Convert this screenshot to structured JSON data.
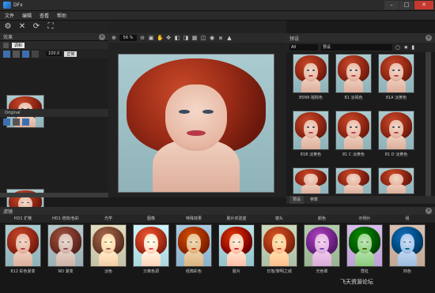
{
  "window": {
    "title": "DFx"
  },
  "menu": [
    "文件",
    "编辑",
    "查看",
    "帮助"
  ],
  "left_panel": {
    "title": "效果",
    "layer_name": "调和",
    "opacity_value": "100.0",
    "blend_mode": "正常",
    "original_label": "Original"
  },
  "zoom": {
    "value": "56 %"
  },
  "right_panel": {
    "title": "预设",
    "category_select": "All",
    "filter_label": "预设",
    "presets": [
      [
        "85N9 褪棕色",
        "81 淡褐色",
        "81A 淡黄色"
      ],
      [
        "81B 淡黄色",
        "81 C 淡黄色",
        "81 D 淡黄色"
      ],
      [
        "",
        "",
        ""
      ]
    ],
    "tabs": [
      "预设",
      "参数"
    ]
  },
  "bottom_panel": {
    "title": "滤镜",
    "categories": [
      "HD1 扩散",
      "HD1 增效/色彩",
      "光学",
      "图像",
      "特殊效果",
      "胶片实验室",
      "镜头",
      "颜色",
      "示例片",
      "组"
    ],
    "thumbnails": [
      "812 彩色渐变",
      "ND 渐变",
      "淡色",
      "分离色调",
      "经典彩色",
      "胶片",
      "日落/黎明之城",
      "光色晕",
      "霓虹",
      "四色"
    ]
  },
  "watermark": "飞天资源论坛"
}
